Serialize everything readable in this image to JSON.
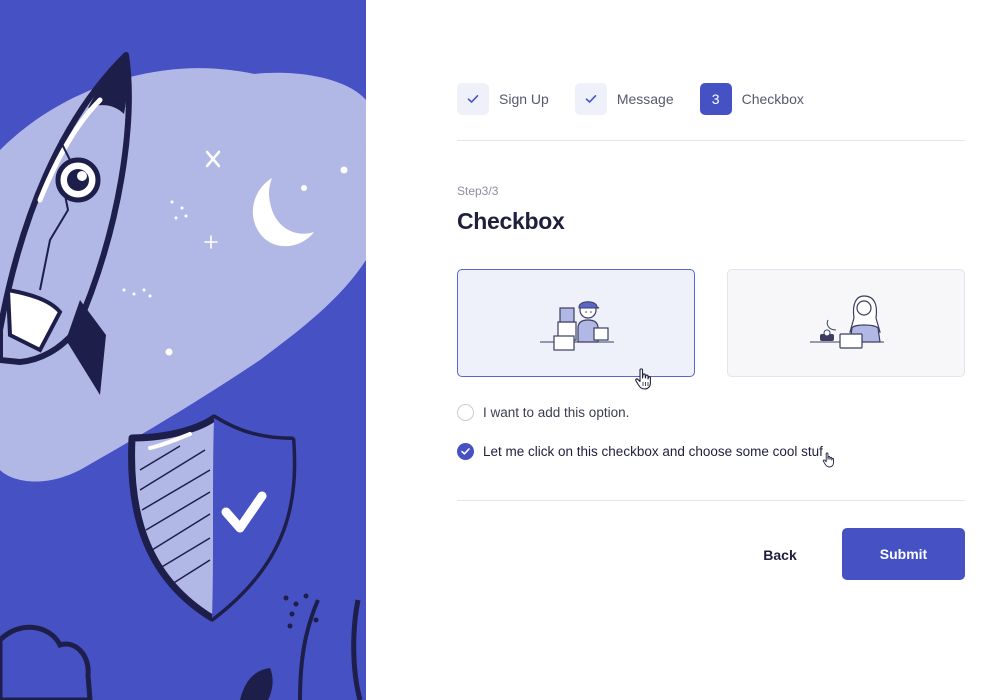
{
  "stepper": {
    "steps": [
      {
        "label": "Sign Up",
        "state": "done",
        "icon": "check-icon"
      },
      {
        "label": "Message",
        "state": "done",
        "icon": "check-icon"
      },
      {
        "label": "Checkbox",
        "state": "active",
        "number": "3"
      }
    ]
  },
  "form": {
    "step_count": "Step3/3",
    "title": "Checkbox",
    "cards": [
      {
        "illustration": "delivery-person-illustration",
        "selected": true
      },
      {
        "illustration": "woman-at-laptop-illustration",
        "selected": false
      }
    ],
    "options": [
      {
        "label": "I want to add this option.",
        "checked": false
      },
      {
        "label": "Let me click on this checkbox and choose some cool stuf",
        "checked": true
      }
    ]
  },
  "actions": {
    "back_label": "Back",
    "submit_label": "Submit"
  },
  "colors": {
    "accent": "#4651c4",
    "accent_light": "#eef0fa",
    "text_dark": "#1f1f3d",
    "text_muted": "#8b8ea1",
    "illustration_light": "#b2b8e6"
  }
}
